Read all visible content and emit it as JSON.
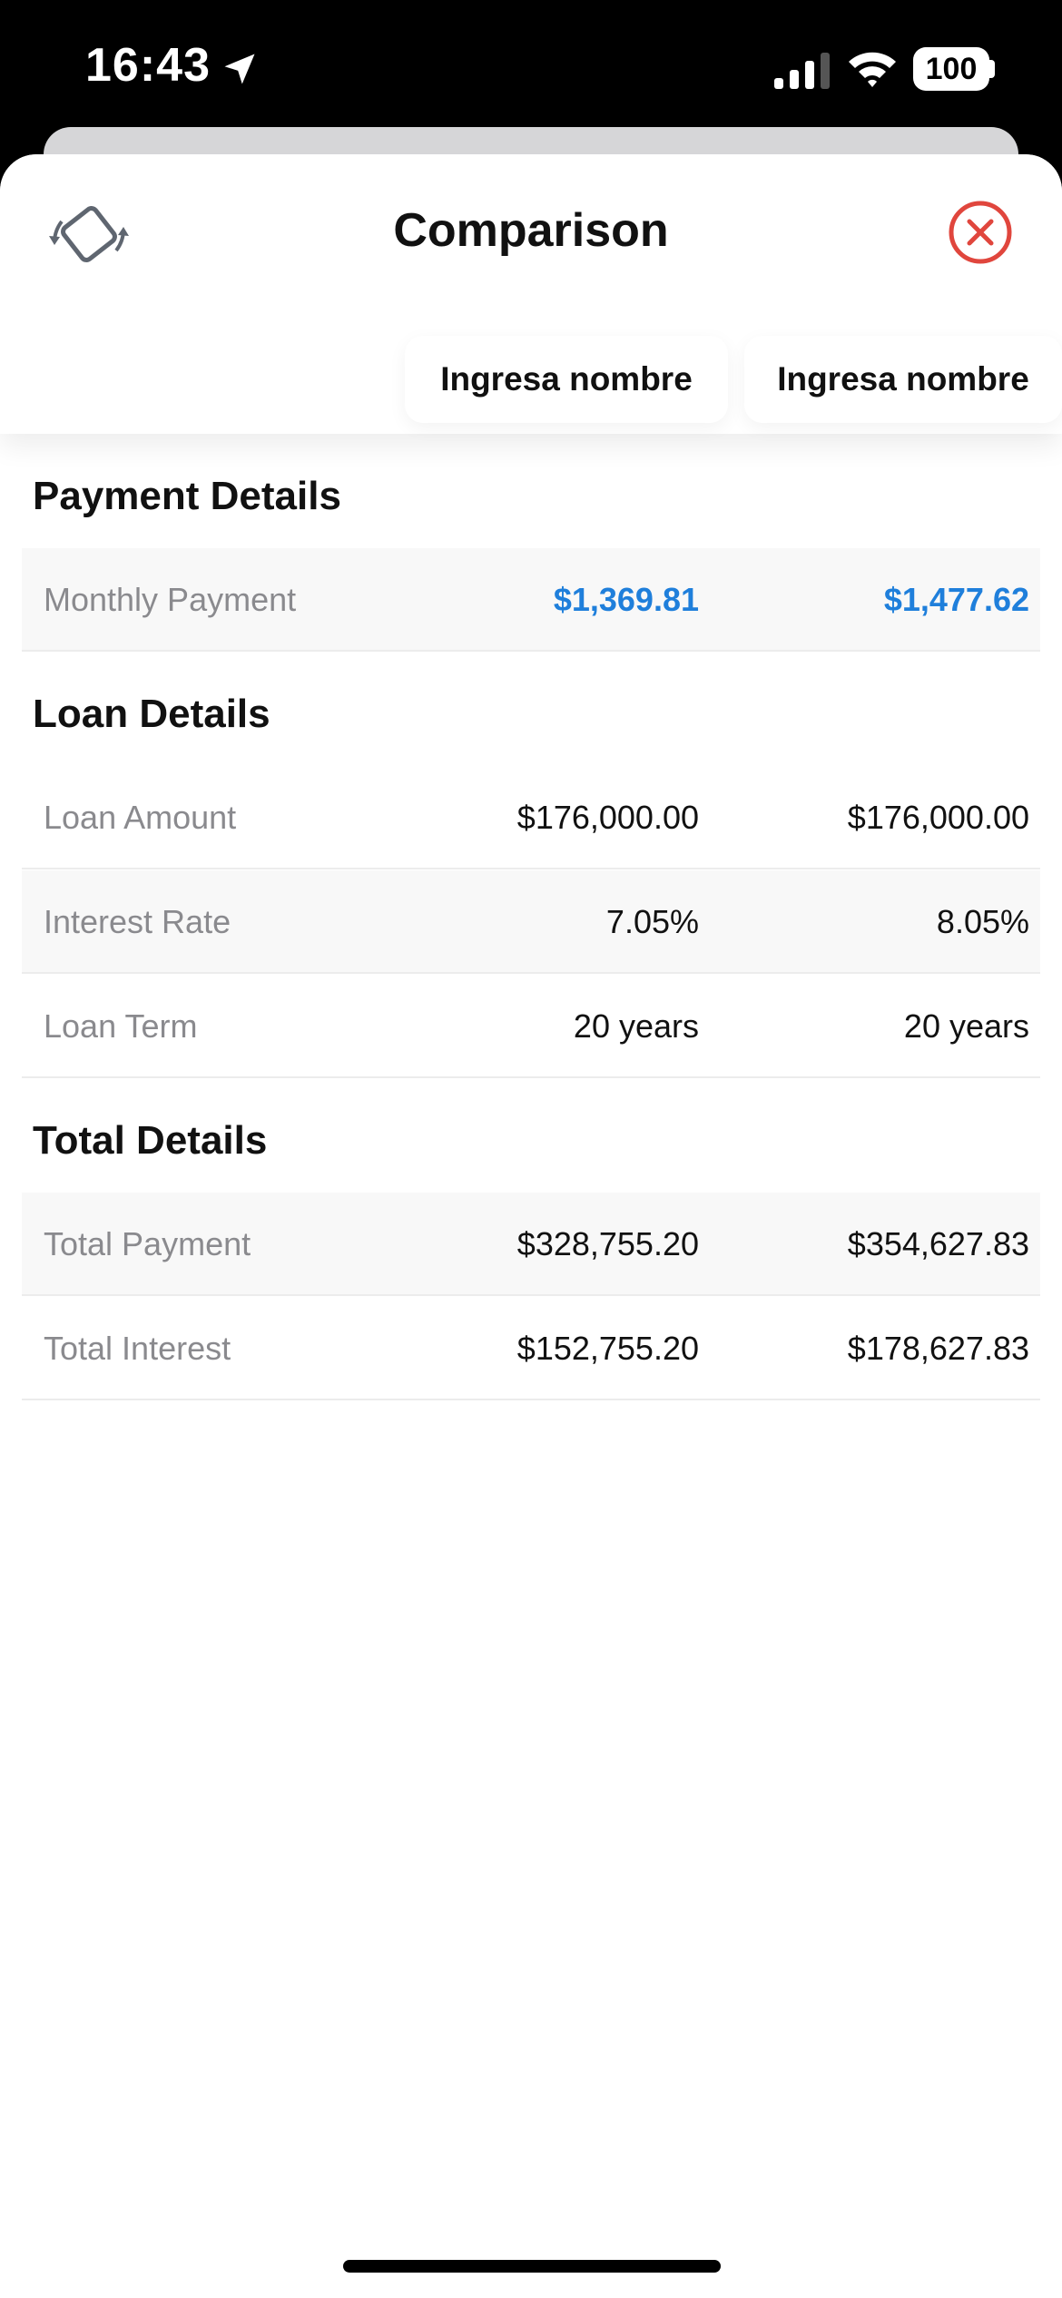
{
  "status_bar": {
    "time": "16:43",
    "battery": "100",
    "icons": [
      "location-arrow-icon",
      "cellular-signal-icon",
      "wifi-icon",
      "battery-icon"
    ]
  },
  "header": {
    "title": "Comparison",
    "rotate_icon": "rotate-device-icon",
    "close_icon": "close-circle-icon",
    "close_color": "#e0463d",
    "name_placeholders": [
      "Ingresa nombre",
      "Ingresa nombre"
    ]
  },
  "accent_color": "#1f7fdb",
  "sections": [
    {
      "title": "Payment Details",
      "rows": [
        {
          "label": "Monthly Payment",
          "values": [
            "$1,369.81",
            "$1,477.62"
          ],
          "accent": true
        }
      ]
    },
    {
      "title": "Loan Details",
      "rows": [
        {
          "label": "Loan Amount",
          "values": [
            "$176,000.00",
            "$176,000.00"
          ]
        },
        {
          "label": "Interest Rate",
          "values": [
            "7.05%",
            "8.05%"
          ]
        },
        {
          "label": "Loan Term",
          "values": [
            "20 years",
            "20 years"
          ]
        }
      ]
    },
    {
      "title": "Total Details",
      "rows": [
        {
          "label": "Total Payment",
          "values": [
            "$328,755.20",
            "$354,627.83"
          ]
        },
        {
          "label": "Total Interest",
          "values": [
            "$152,755.20",
            "$178,627.83"
          ]
        }
      ]
    }
  ]
}
